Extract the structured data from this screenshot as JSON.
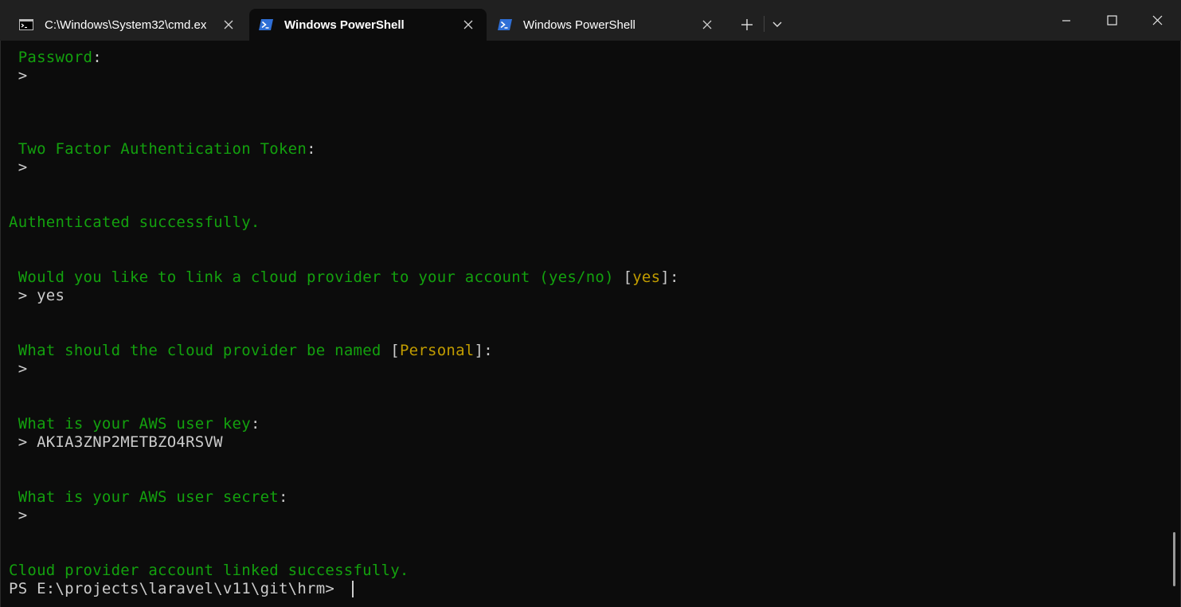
{
  "tabs": [
    {
      "title": "C:\\Windows\\System32\\cmd.ex",
      "icon": "cmd-icon",
      "active": false
    },
    {
      "title": "Windows PowerShell",
      "icon": "powershell-icon",
      "active": true
    },
    {
      "title": "Windows PowerShell",
      "icon": "powershell-icon",
      "active": false
    }
  ],
  "tab_controls": {
    "new_tab": "+",
    "dropdown": "chevron-down-icon"
  },
  "window_controls": {
    "minimize": "minimize-icon",
    "maximize": "maximize-icon",
    "close": "close-icon"
  },
  "colors": {
    "green": "#13a10e",
    "yellow": "#c19c00",
    "text": "#cccccc",
    "background": "#0c0c0c",
    "titlebar": "#202020"
  },
  "terminal": {
    "password_label": "Password",
    "colon": ":",
    "prompt_arrow": ">",
    "prompt_arrow_space": "> ",
    "tfa_label": "Two Factor Authentication Token",
    "auth_success": "Authenticated successfully.",
    "link_question": "Would you like to link a cloud provider to your account (yes/no)",
    "link_default": "yes",
    "link_answer": "yes",
    "name_question": "What should the cloud provider be named",
    "name_default": "Personal",
    "key_question": "What is your AWS user key",
    "key_answer": "AKIA3ZNP2METBZO4RSVW",
    "secret_question": "What is your AWS user secret",
    "linked_success": "Cloud provider account linked successfully.",
    "ps_prompt": "PS E:\\projects\\laravel\\v11\\git\\hrm> "
  }
}
